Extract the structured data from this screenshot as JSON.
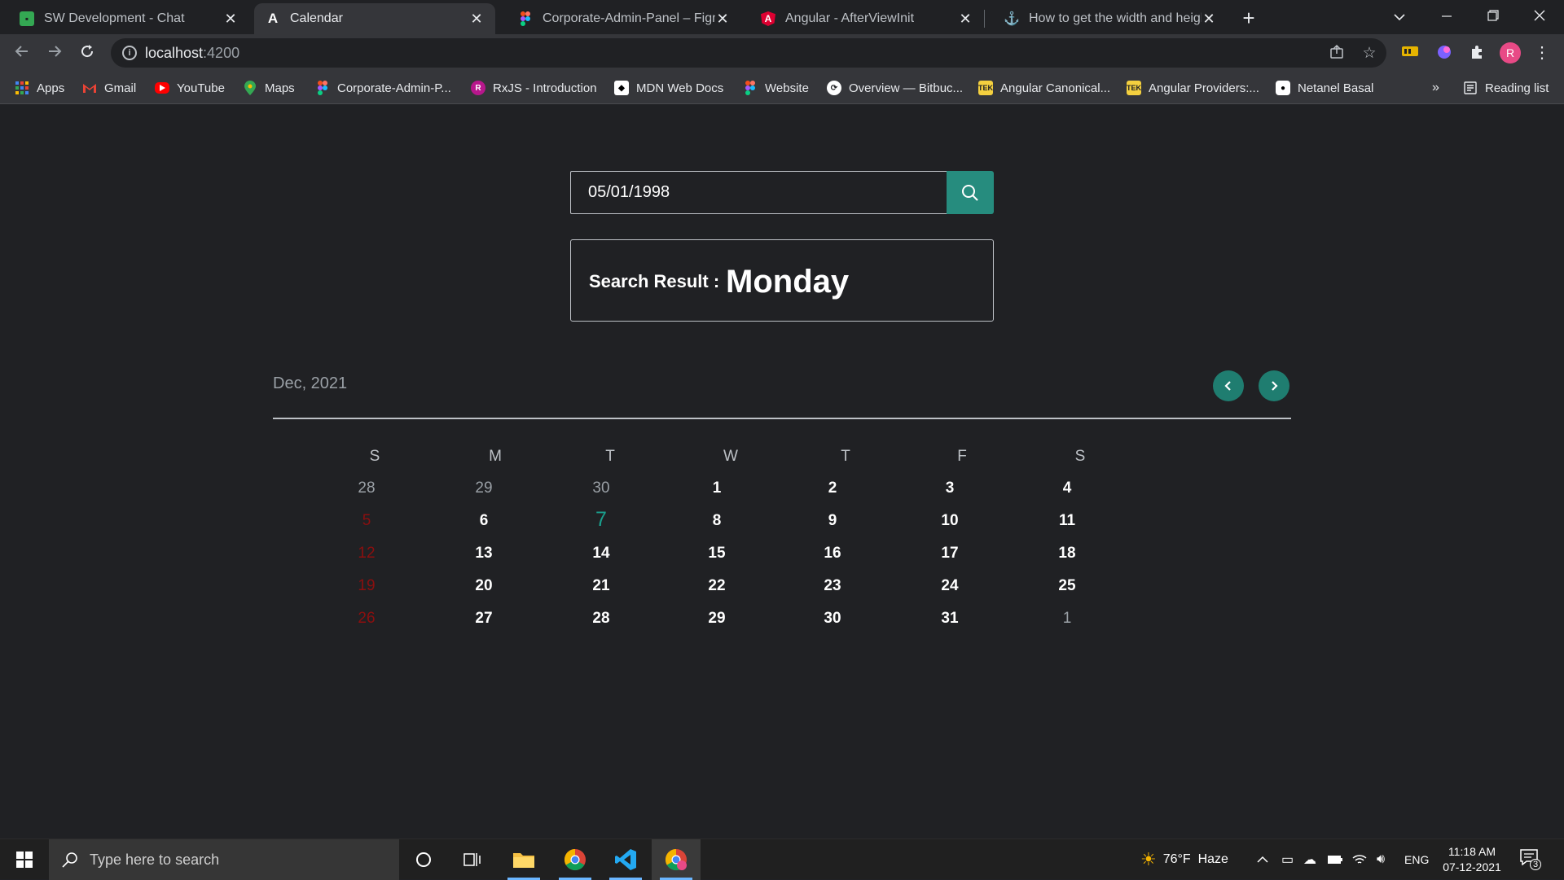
{
  "browser": {
    "tabs": [
      {
        "title": "SW Development - Chat",
        "icon": "google-chat-icon",
        "color": "#34a853"
      },
      {
        "title": "Calendar",
        "icon": "angular-dev-icon",
        "color": "#e8eaed"
      },
      {
        "title": "Corporate-Admin-Panel – Figma",
        "icon": "figma-icon",
        "color": "#f24e1e"
      },
      {
        "title": "Angular - AfterViewInit",
        "icon": "angular-icon",
        "color": "#dd0031"
      },
      {
        "title": "How to get the width and height",
        "icon": "anchor-icon",
        "color": "#9aa0a6"
      }
    ],
    "close_glyph": "✕",
    "new_tab_glyph": "+",
    "url_host": "localhost",
    "url_port": ":4200",
    "profile_initial": "R",
    "bookmarks": [
      {
        "label": "Apps",
        "icon": "apps-grid-icon"
      },
      {
        "label": "Gmail",
        "icon": "gmail-icon"
      },
      {
        "label": "YouTube",
        "icon": "youtube-icon"
      },
      {
        "label": "Maps",
        "icon": "maps-icon"
      },
      {
        "label": "Corporate-Admin-P...",
        "icon": "figma-icon"
      },
      {
        "label": "RxJS - Introduction",
        "icon": "rxjs-icon"
      },
      {
        "label": "MDN Web Docs",
        "icon": "mdn-icon"
      },
      {
        "label": "Website",
        "icon": "figma-icon"
      },
      {
        "label": "Overview — Bitbuc...",
        "icon": "bitbucket-icon"
      },
      {
        "label": "Angular Canonical...",
        "icon": "tek-icon"
      },
      {
        "label": "Angular Providers:...",
        "icon": "tek-icon"
      },
      {
        "label": "Netanel Basal",
        "icon": "netanel-icon"
      }
    ],
    "more_bookmarks": "»",
    "reading_list": "Reading list"
  },
  "app": {
    "search": {
      "value": "05/01/1998"
    },
    "result": {
      "label": "Search Result :",
      "value": "Monday"
    },
    "calendar": {
      "month_label": "Dec, 2021",
      "weekdays": [
        "S",
        "M",
        "T",
        "W",
        "T",
        "F",
        "S"
      ],
      "weeks": [
        [
          {
            "d": "28",
            "t": "other"
          },
          {
            "d": "29",
            "t": "other"
          },
          {
            "d": "30",
            "t": "other"
          },
          {
            "d": "1",
            "t": "cur"
          },
          {
            "d": "2",
            "t": "cur"
          },
          {
            "d": "3",
            "t": "cur"
          },
          {
            "d": "4",
            "t": "cur"
          }
        ],
        [
          {
            "d": "5",
            "t": "sun"
          },
          {
            "d": "6",
            "t": "cur"
          },
          {
            "d": "7",
            "t": "today"
          },
          {
            "d": "8",
            "t": "cur"
          },
          {
            "d": "9",
            "t": "cur"
          },
          {
            "d": "10",
            "t": "cur"
          },
          {
            "d": "11",
            "t": "cur"
          }
        ],
        [
          {
            "d": "12",
            "t": "sun"
          },
          {
            "d": "13",
            "t": "cur"
          },
          {
            "d": "14",
            "t": "cur"
          },
          {
            "d": "15",
            "t": "cur"
          },
          {
            "d": "16",
            "t": "cur"
          },
          {
            "d": "17",
            "t": "cur"
          },
          {
            "d": "18",
            "t": "cur"
          }
        ],
        [
          {
            "d": "19",
            "t": "sun"
          },
          {
            "d": "20",
            "t": "cur"
          },
          {
            "d": "21",
            "t": "cur"
          },
          {
            "d": "22",
            "t": "cur"
          },
          {
            "d": "23",
            "t": "cur"
          },
          {
            "d": "24",
            "t": "cur"
          },
          {
            "d": "25",
            "t": "cur"
          }
        ],
        [
          {
            "d": "26",
            "t": "sun"
          },
          {
            "d": "27",
            "t": "cur"
          },
          {
            "d": "28",
            "t": "cur"
          },
          {
            "d": "29",
            "t": "cur"
          },
          {
            "d": "30",
            "t": "cur"
          },
          {
            "d": "31",
            "t": "cur"
          },
          {
            "d": "1",
            "t": "other"
          }
        ]
      ],
      "accent": "#268c7e",
      "sunday_color": "#8b0f0f"
    }
  },
  "taskbar": {
    "search_placeholder": "Type here to search",
    "weather": "76°F  Haze",
    "language": "ENG",
    "time": "11:18 AM",
    "date": "07-12-2021",
    "notification_count": "3"
  }
}
